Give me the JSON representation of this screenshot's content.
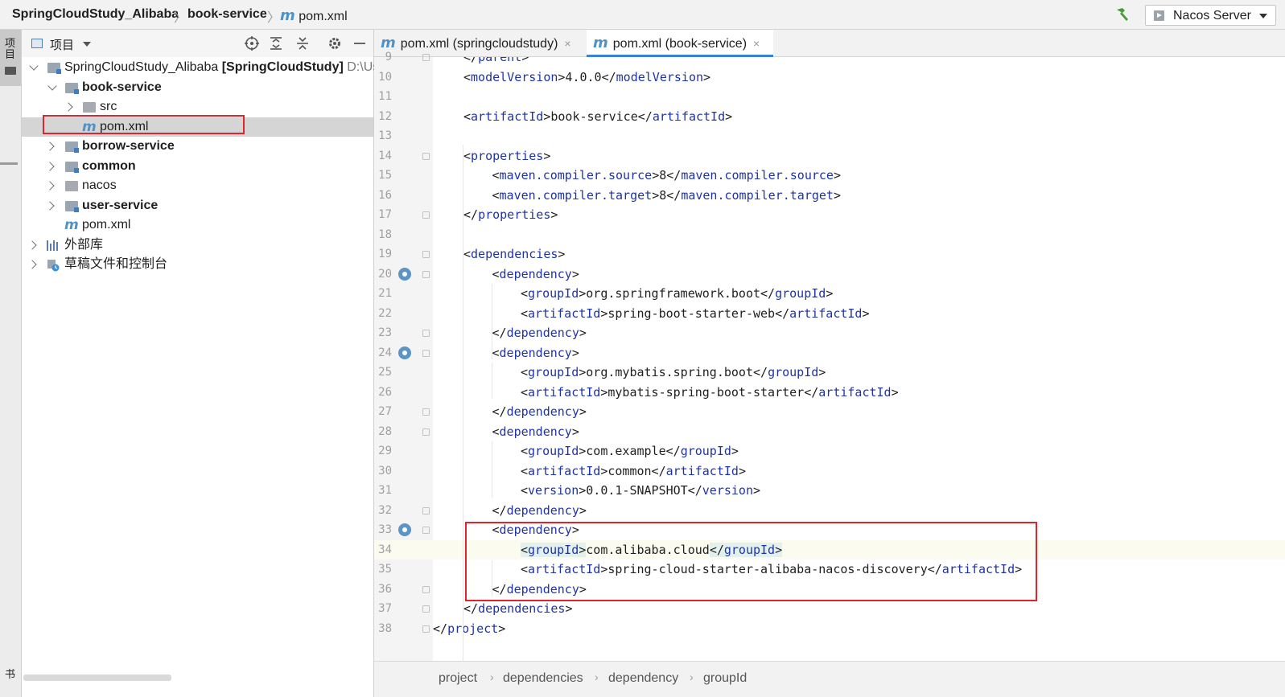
{
  "breadcrumb": {
    "project": "SpringCloudStudy_Alibaba",
    "module": "book-service",
    "file_glyph": "m",
    "file": "pom.xml"
  },
  "run_config": {
    "label": "Nacos Server"
  },
  "left_strip": {
    "project_label": "项目",
    "bottom_label": "书"
  },
  "project_panel": {
    "title": "项目",
    "tree": {
      "root_name": "SpringCloudStudy_Alibaba",
      "root_project": "[SpringCloudStudy]",
      "root_path": "D:\\Us",
      "book_service": "book-service",
      "src": "src",
      "book_pom_glyph": "m",
      "book_pom": "pom.xml",
      "borrow_service": "borrow-service",
      "common": "common",
      "nacos": "nacos",
      "user_service": "user-service",
      "root_pom_glyph": "m",
      "root_pom": "pom.xml",
      "external_libs": "外部库",
      "scratches": "草稿文件和控制台"
    }
  },
  "tabs": [
    {
      "glyph": "m",
      "label": "pom.xml (springcloudstudy)",
      "close": "×",
      "active": false
    },
    {
      "glyph": "m",
      "label": "pom.xml (book-service)",
      "close": "×",
      "active": true
    }
  ],
  "editor": {
    "current_line": 34,
    "lines": [
      {
        "n": "9",
        "indent": 1,
        "parts": [
          [
            "brk",
            "</"
          ],
          [
            "tag",
            "parent"
          ],
          [
            "brk",
            ">"
          ]
        ]
      },
      {
        "n": "10",
        "indent": 1,
        "parts": [
          [
            "brk",
            "<"
          ],
          [
            "tag",
            "modelVersion"
          ],
          [
            "brk",
            ">4.0.0</"
          ],
          [
            "tag",
            "modelVersion"
          ],
          [
            "brk",
            ">"
          ]
        ]
      },
      {
        "n": "11",
        "indent": 0,
        "parts": []
      },
      {
        "n": "12",
        "indent": 1,
        "parts": [
          [
            "brk",
            "<"
          ],
          [
            "tag",
            "artifactId"
          ],
          [
            "brk",
            ">book-service</"
          ],
          [
            "tag",
            "artifactId"
          ],
          [
            "brk",
            ">"
          ]
        ]
      },
      {
        "n": "13",
        "indent": 0,
        "parts": []
      },
      {
        "n": "14",
        "indent": 1,
        "parts": [
          [
            "brk",
            "<"
          ],
          [
            "tag",
            "properties"
          ],
          [
            "brk",
            ">"
          ]
        ]
      },
      {
        "n": "15",
        "indent": 2,
        "parts": [
          [
            "brk",
            "<"
          ],
          [
            "tag",
            "maven.compiler.source"
          ],
          [
            "brk",
            ">8</"
          ],
          [
            "tag",
            "maven.compiler.source"
          ],
          [
            "brk",
            ">"
          ]
        ]
      },
      {
        "n": "16",
        "indent": 2,
        "parts": [
          [
            "brk",
            "<"
          ],
          [
            "tag",
            "maven.compiler.target"
          ],
          [
            "brk",
            ">8</"
          ],
          [
            "tag",
            "maven.compiler.target"
          ],
          [
            "brk",
            ">"
          ]
        ]
      },
      {
        "n": "17",
        "indent": 1,
        "parts": [
          [
            "brk",
            "</"
          ],
          [
            "tag",
            "properties"
          ],
          [
            "brk",
            ">"
          ]
        ]
      },
      {
        "n": "18",
        "indent": 0,
        "parts": []
      },
      {
        "n": "19",
        "indent": 1,
        "parts": [
          [
            "brk",
            "<"
          ],
          [
            "tag",
            "dependencies"
          ],
          [
            "brk",
            ">"
          ]
        ]
      },
      {
        "n": "20",
        "indent": 2,
        "parts": [
          [
            "brk",
            "<"
          ],
          [
            "tag",
            "dependency"
          ],
          [
            "brk",
            ">"
          ]
        ]
      },
      {
        "n": "21",
        "indent": 3,
        "parts": [
          [
            "brk",
            "<"
          ],
          [
            "tag",
            "groupId"
          ],
          [
            "brk",
            ">org.springframework.boot</"
          ],
          [
            "tag",
            "groupId"
          ],
          [
            "brk",
            ">"
          ]
        ]
      },
      {
        "n": "22",
        "indent": 3,
        "parts": [
          [
            "brk",
            "<"
          ],
          [
            "tag",
            "artifactId"
          ],
          [
            "brk",
            ">spring-boot-starter-web</"
          ],
          [
            "tag",
            "artifactId"
          ],
          [
            "brk",
            ">"
          ]
        ]
      },
      {
        "n": "23",
        "indent": 2,
        "parts": [
          [
            "brk",
            "</"
          ],
          [
            "tag",
            "dependency"
          ],
          [
            "brk",
            ">"
          ]
        ]
      },
      {
        "n": "24",
        "indent": 2,
        "parts": [
          [
            "brk",
            "<"
          ],
          [
            "tag",
            "dependency"
          ],
          [
            "brk",
            ">"
          ]
        ]
      },
      {
        "n": "25",
        "indent": 3,
        "parts": [
          [
            "brk",
            "<"
          ],
          [
            "tag",
            "groupId"
          ],
          [
            "brk",
            ">org.mybatis.spring.boot</"
          ],
          [
            "tag",
            "groupId"
          ],
          [
            "brk",
            ">"
          ]
        ]
      },
      {
        "n": "26",
        "indent": 3,
        "parts": [
          [
            "brk",
            "<"
          ],
          [
            "tag",
            "artifactId"
          ],
          [
            "brk",
            ">mybatis-spring-boot-starter</"
          ],
          [
            "tag",
            "artifactId"
          ],
          [
            "brk",
            ">"
          ]
        ]
      },
      {
        "n": "27",
        "indent": 2,
        "parts": [
          [
            "brk",
            "</"
          ],
          [
            "tag",
            "dependency"
          ],
          [
            "brk",
            ">"
          ]
        ]
      },
      {
        "n": "28",
        "indent": 2,
        "parts": [
          [
            "brk",
            "<"
          ],
          [
            "tag",
            "dependency"
          ],
          [
            "brk",
            ">"
          ]
        ]
      },
      {
        "n": "29",
        "indent": 3,
        "parts": [
          [
            "brk",
            "<"
          ],
          [
            "tag",
            "groupId"
          ],
          [
            "brk",
            ">com.example</"
          ],
          [
            "tag",
            "groupId"
          ],
          [
            "brk",
            ">"
          ]
        ]
      },
      {
        "n": "30",
        "indent": 3,
        "parts": [
          [
            "brk",
            "<"
          ],
          [
            "tag",
            "artifactId"
          ],
          [
            "brk",
            ">common</"
          ],
          [
            "tag",
            "artifactId"
          ],
          [
            "brk",
            ">"
          ]
        ]
      },
      {
        "n": "31",
        "indent": 3,
        "parts": [
          [
            "brk",
            "<"
          ],
          [
            "tag",
            "version"
          ],
          [
            "brk",
            ">0.0.1-SNAPSHOT</"
          ],
          [
            "tag",
            "version"
          ],
          [
            "brk",
            ">"
          ]
        ]
      },
      {
        "n": "32",
        "indent": 2,
        "parts": [
          [
            "brk",
            "</"
          ],
          [
            "tag",
            "dependency"
          ],
          [
            "brk",
            ">"
          ]
        ]
      },
      {
        "n": "33",
        "indent": 2,
        "parts": [
          [
            "brk",
            "<"
          ],
          [
            "tag",
            "dependency"
          ],
          [
            "brk",
            ">"
          ]
        ]
      },
      {
        "n": "34",
        "indent": 3,
        "parts": [
          [
            "hl",
            "<"
          ],
          [
            "hltag",
            "groupId"
          ],
          [
            "hl",
            ">"
          ],
          [
            "brk",
            "com.alibaba.cloud"
          ],
          [
            "hl",
            "</"
          ],
          [
            "hltag",
            "groupId"
          ],
          [
            "hl",
            ">"
          ]
        ]
      },
      {
        "n": "35",
        "indent": 3,
        "parts": [
          [
            "brk",
            "<"
          ],
          [
            "tag",
            "artifactId"
          ],
          [
            "brk",
            ">spring-cloud-starter-alibaba-nacos-discovery</"
          ],
          [
            "tag",
            "artifactId"
          ],
          [
            "brk",
            ">"
          ]
        ]
      },
      {
        "n": "36",
        "indent": 2,
        "parts": [
          [
            "brk",
            "</"
          ],
          [
            "tag",
            "dependency"
          ],
          [
            "brk",
            ">"
          ]
        ]
      },
      {
        "n": "37",
        "indent": 1,
        "parts": [
          [
            "brk",
            "</"
          ],
          [
            "tag",
            "dependencies"
          ],
          [
            "brk",
            ">"
          ]
        ]
      },
      {
        "n": "38",
        "indent": 0,
        "parts": [
          [
            "brk",
            "</"
          ],
          [
            "tag",
            "project"
          ],
          [
            "brk",
            ">"
          ]
        ]
      }
    ]
  },
  "status_breadcrumb": [
    "project",
    "dependencies",
    "dependency",
    "groupId"
  ],
  "colors": {
    "tag": "#1e33a8",
    "highlight_box": "#e3f1ee",
    "annotation_red": "#e0242f",
    "maven_m": "#4f92c7",
    "active_tab_underline": "#3b82d6"
  }
}
